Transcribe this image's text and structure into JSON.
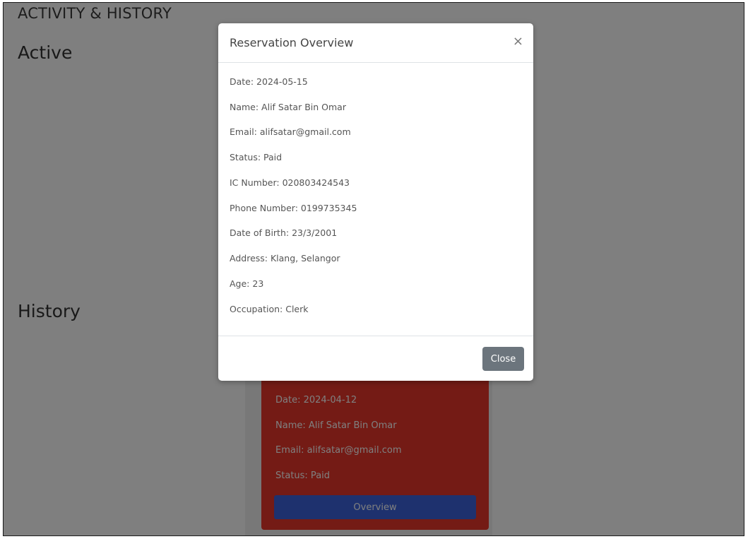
{
  "page": {
    "title": "ACTIVITY & HISTORY",
    "active_heading": "Active",
    "history_heading": "History"
  },
  "history_card": {
    "date": "Date: 2024-04-12",
    "name": "Name: Alif Satar Bin Omar",
    "email": "Email: alifsatar@gmail.com",
    "status": "Status: Paid",
    "overview_label": "Overview"
  },
  "modal": {
    "title": "Reservation Overview",
    "close_icon": "×",
    "fields": [
      "Date: 2024-05-15",
      "Name: Alif Satar Bin Omar",
      "Email: alifsatar@gmail.com",
      "Status: Paid",
      "IC Number: 020803424543",
      "Phone Number: 0199735345",
      "Date of Birth: 23/3/2001",
      "Address: Klang, Selangor",
      "Age: 23",
      "Occupation: Clerk"
    ],
    "close_label": "Close"
  },
  "colors": {
    "card_background": "#e8372a",
    "overview_button": "#3d63dd",
    "close_button": "#6c757d",
    "backdrop": "rgba(0,0,0,0.5)"
  }
}
